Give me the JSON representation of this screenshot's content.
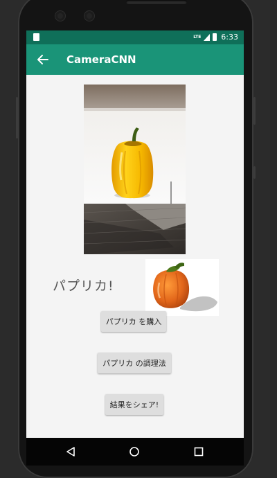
{
  "status_bar": {
    "network": "LTE",
    "time": "6:33",
    "icons": [
      "sim-icon",
      "signal-icon",
      "battery-icon"
    ]
  },
  "app_bar": {
    "title": "CameraCNN",
    "back_icon": "arrow-back-icon"
  },
  "main": {
    "result_text": "パプリカ!",
    "buttons": {
      "buy": "パプリカ を購入",
      "recipe": "パプリカ の調理法",
      "share": "結果をシェア!"
    }
  },
  "nav_bar": {
    "icons": [
      "nav-back-icon",
      "nav-home-icon",
      "nav-recent-icon"
    ]
  },
  "colors": {
    "status_bar": "#0f6f59",
    "app_bar": "#1a9478",
    "content_bg": "#f4f4f4",
    "button_bg": "#dedede",
    "nav_bar": "#050505"
  }
}
